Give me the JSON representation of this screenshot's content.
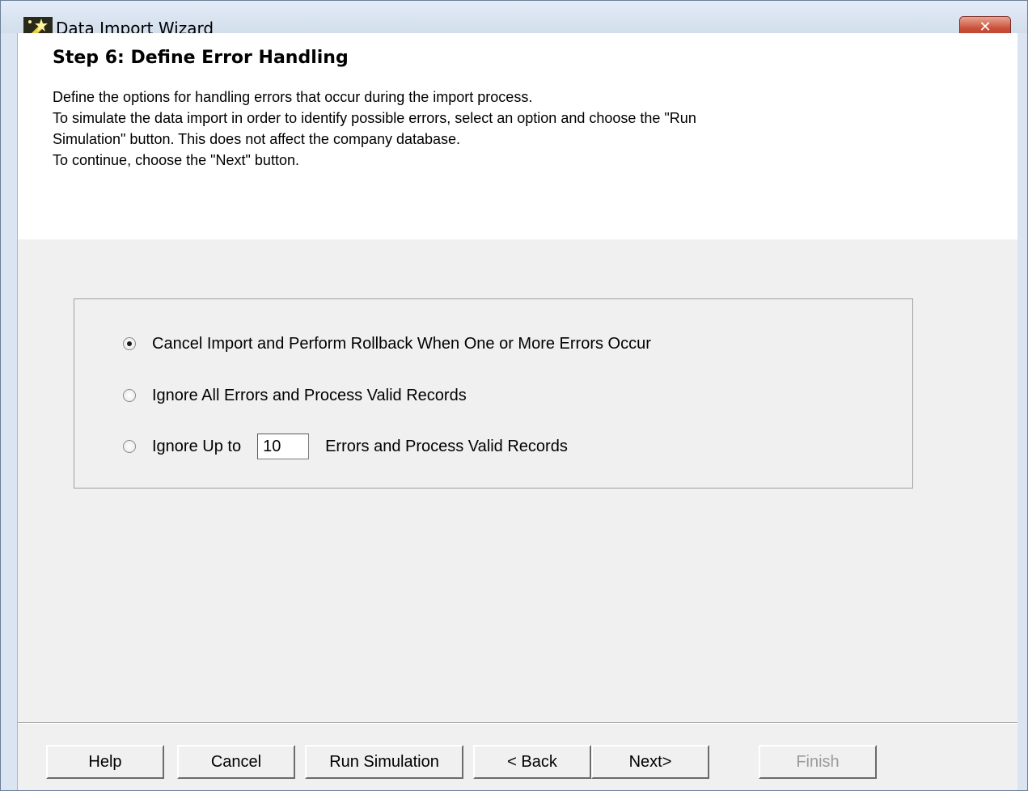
{
  "window": {
    "title": "Data Import Wizard",
    "close_symbol": "✕"
  },
  "header": {
    "step_title": "Step 6: Define Error Handling",
    "lines": [
      "Define the options for handling errors that occur during the import process.",
      "To simulate the data import in order to identify possible errors, select an option and choose the \"Run",
      "Simulation\" button. This does not affect the company database.",
      "To continue, choose the \"Next\" button."
    ]
  },
  "options": {
    "cancel_rollback": {
      "label": "Cancel Import and Perform Rollback When One or More Errors Occur",
      "selected": true
    },
    "ignore_all": {
      "label": "Ignore All Errors and Process Valid Records",
      "selected": false
    },
    "ignore_up_to": {
      "label_before": "Ignore Up to",
      "value": "10",
      "label_after": "Errors and Process Valid Records",
      "selected": false
    }
  },
  "buttons": {
    "help": "Help",
    "cancel": "Cancel",
    "run_simulation": "Run Simulation",
    "back": "< Back",
    "next": "Next>",
    "finish": "Finish"
  },
  "icons": {
    "title_icon": "wizard-wand-icon",
    "close": "close-icon"
  }
}
